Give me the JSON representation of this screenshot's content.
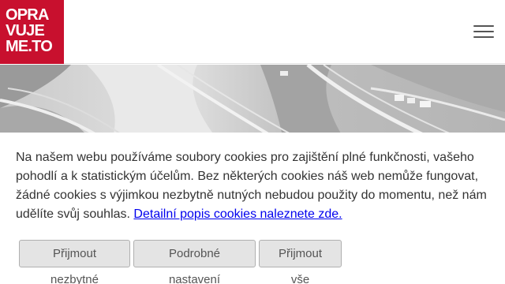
{
  "header": {
    "logo": {
      "line1": "OPRA",
      "line2": "VUJE",
      "line3": "ME.TO",
      "color": "#c8102e"
    },
    "menu_icon": "hamburger-menu-icon"
  },
  "hero": {
    "image": "grayscale-aerial-photo-river-highway"
  },
  "cookie_banner": {
    "text": "Na našem webu používáme soubory cookies pro zajištění plné funkčnosti, vašeho pohodlí a k statistickým účelům. Bez některých cookies náš web nemůže fungovat, žádné cookies s výjimkou nezbytně nutných nebudou použity do momentu, než nám udělíte svůj souhlas. ",
    "link_text": "Detailní popis cookies naleznete zde.",
    "buttons": {
      "accept_necessary": "Přijmout nezbytné",
      "detailed_settings": "Podrobné nastavení",
      "accept_all": "Přijmout vše"
    }
  }
}
